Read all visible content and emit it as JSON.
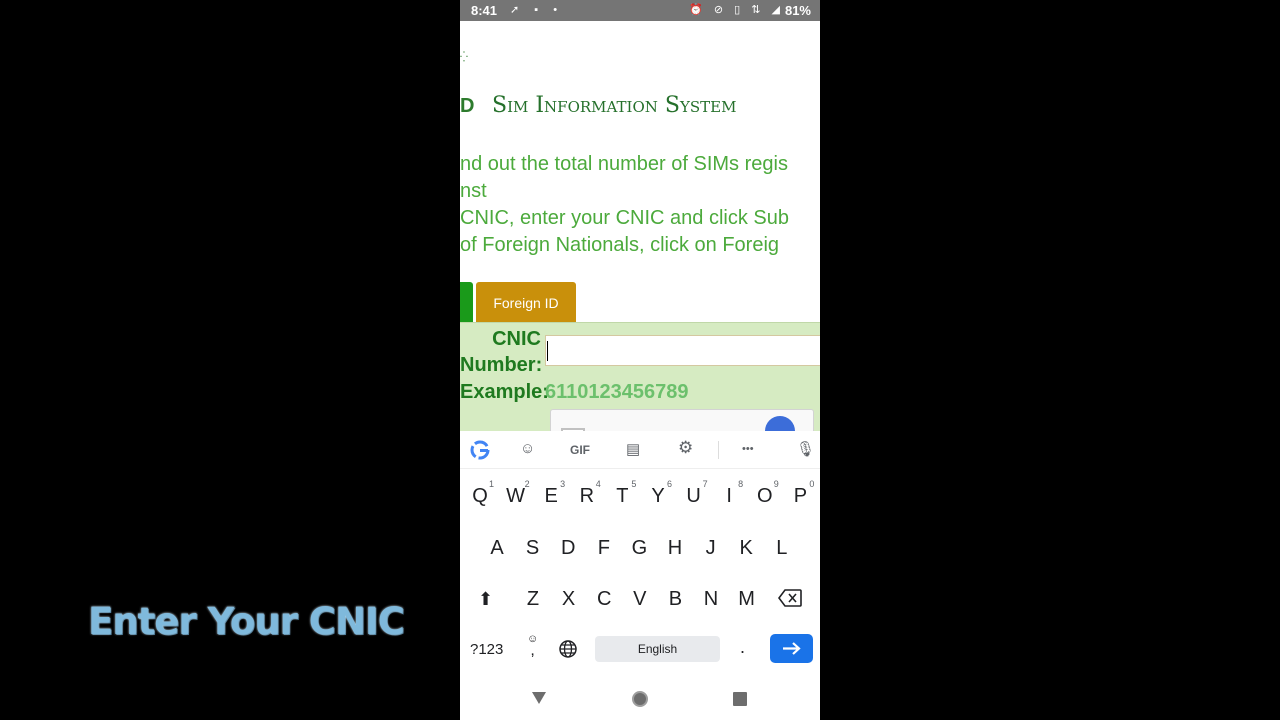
{
  "caption": "Enter Your CNIC",
  "status_bar": {
    "time": "8:41",
    "left_icons": "➚ ▪ •",
    "right_icons": "⏰ ⊘ ▯ ⇅ ◢",
    "battery": "81%"
  },
  "web": {
    "logo_mark": "⁛",
    "logo_letter": "D",
    "site_title": "Sim Information System",
    "intro_lines": [
      "nd out the total number of SIMs regis",
      "nst",
      "CNIC, enter your CNIC and click Sub",
      " of Foreign Nationals, click on Foreig"
    ],
    "tabs": {
      "foreign_id": "Foreign ID"
    },
    "form": {
      "cnic_label": "CNIC Number:",
      "cnic_value": "",
      "example_label": "Example:",
      "example_value": "6110123456789"
    }
  },
  "keyboard": {
    "suggestions": {
      "gif": "GIF",
      "more": "•••"
    },
    "row1": [
      {
        "k": "Q",
        "n": "1"
      },
      {
        "k": "W",
        "n": "2"
      },
      {
        "k": "E",
        "n": "3"
      },
      {
        "k": "R",
        "n": "4"
      },
      {
        "k": "T",
        "n": "5"
      },
      {
        "k": "Y",
        "n": "6"
      },
      {
        "k": "U",
        "n": "7"
      },
      {
        "k": "I",
        "n": "8"
      },
      {
        "k": "O",
        "n": "9"
      },
      {
        "k": "P",
        "n": "0"
      }
    ],
    "row2": [
      "A",
      "S",
      "D",
      "F",
      "G",
      "H",
      "J",
      "K",
      "L"
    ],
    "row3": [
      "Z",
      "X",
      "C",
      "V",
      "B",
      "N",
      "M"
    ],
    "symbols": "?123",
    "emoji": "☺",
    "comma": ",",
    "space": "English",
    "period": ".",
    "shift": "⬆"
  }
}
